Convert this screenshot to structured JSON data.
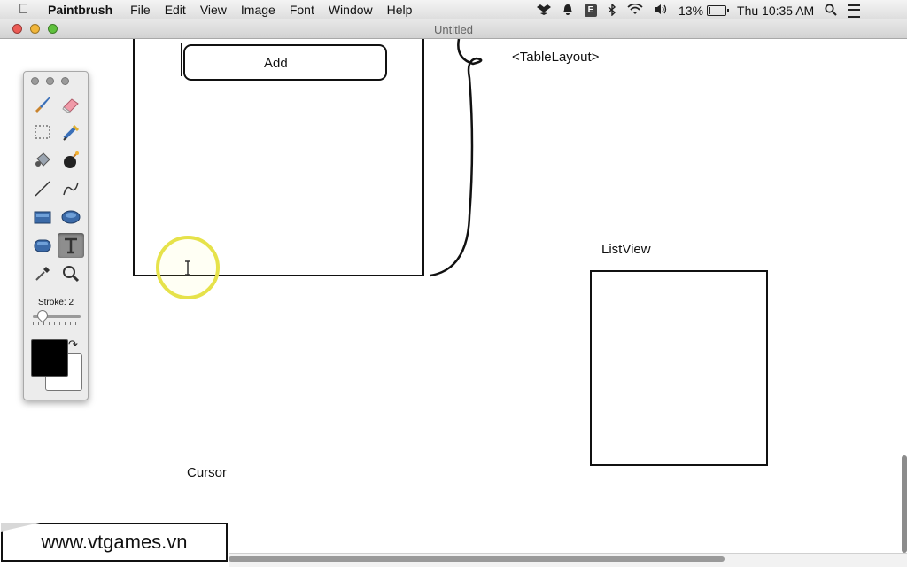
{
  "menubar": {
    "app_name": "Paintbrush",
    "menus": [
      "File",
      "Edit",
      "View",
      "Image",
      "Font",
      "Window",
      "Help"
    ],
    "battery_percent": "13%",
    "battery_level": 0.13,
    "clock": "Thu 10:35 AM",
    "status_icons": [
      "dropbox-icon",
      "notifications-icon",
      "evernote-icon",
      "bluetooth-icon",
      "wifi-icon",
      "volume-icon",
      "battery-icon",
      "spotlight-search-icon",
      "notification-center-icon"
    ]
  },
  "window": {
    "title": "Untitled"
  },
  "canvas": {
    "add_button_label": "Add",
    "table_layout_label": "<TableLayout>",
    "listview_label": "ListView",
    "cursor_label": "Cursor"
  },
  "palette": {
    "stroke_label": "Stroke: 2",
    "stroke_level": 0.2,
    "selected_tool": "text",
    "primary_color": "#000000",
    "secondary_color": "#ffffff",
    "tools": [
      "brush",
      "eraser",
      "select-rectangle",
      "select-lasso",
      "paint-bucket",
      "bomb",
      "line",
      "curve",
      "rectangle",
      "oval",
      "rounded-rectangle",
      "text",
      "eyedropper",
      "zoom"
    ]
  },
  "watermark": {
    "text": "www.vtgames.vn"
  }
}
